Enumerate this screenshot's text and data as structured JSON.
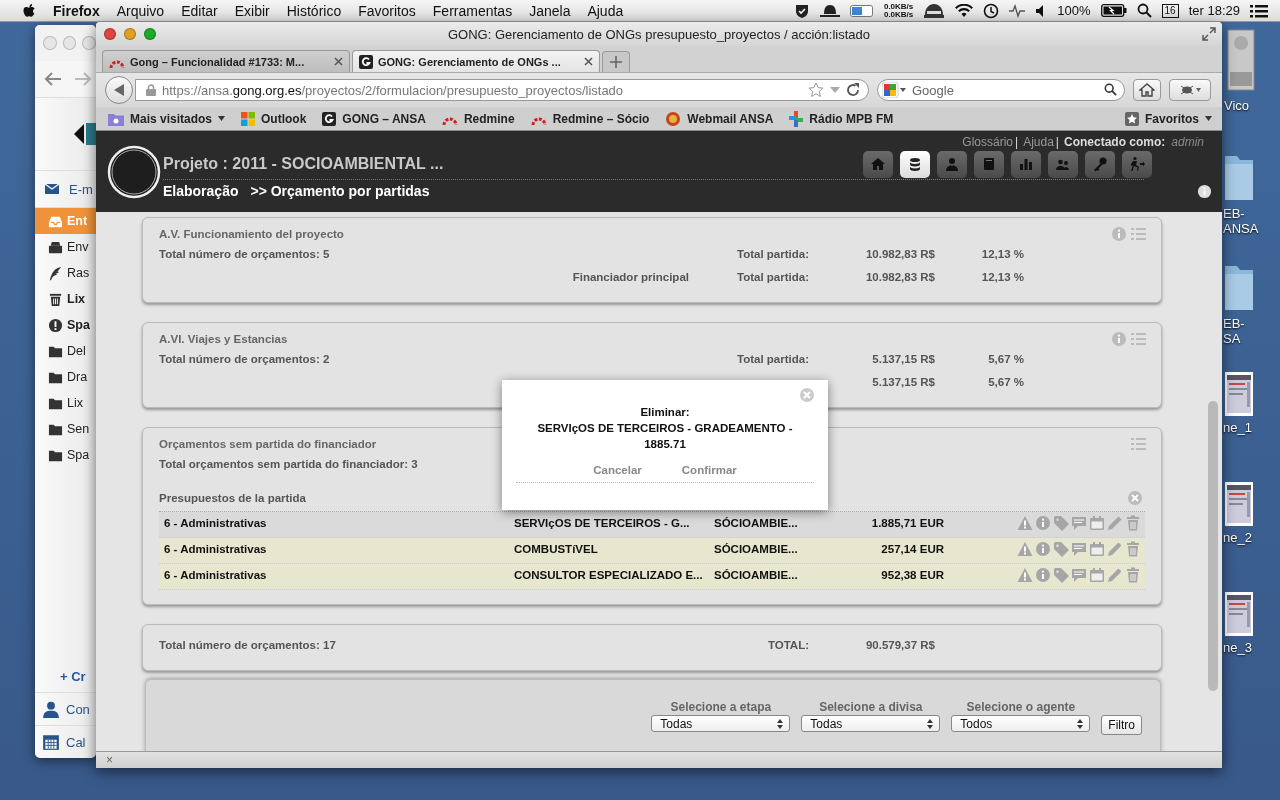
{
  "menubar": {
    "app": "Firefox",
    "menus": [
      "Arquivo",
      "Editar",
      "Exibir",
      "Histórico",
      "Favoritos",
      "Ferramentas",
      "Janela",
      "Ajuda"
    ],
    "status": {
      "net_up": "0.0KB/s",
      "net_down": "0.0KB/s",
      "battery": "100%",
      "calendar_day": "16",
      "clock": "ter 18:29"
    }
  },
  "mail_window": {
    "account": "E-m",
    "folders": [
      {
        "kind": "inbox",
        "label": "Ent",
        "selected": true,
        "bold": true
      },
      {
        "kind": "sent",
        "label": "Env",
        "selected": false,
        "bold": false
      },
      {
        "kind": "drafts",
        "label": "Ras",
        "selected": false,
        "bold": false
      },
      {
        "kind": "trash",
        "label": "Lix",
        "selected": false,
        "bold": true
      },
      {
        "kind": "spam",
        "label": "Spa",
        "selected": false,
        "bold": true
      },
      {
        "kind": "folder",
        "label": "Del",
        "selected": false,
        "bold": false
      },
      {
        "kind": "folder",
        "label": "Dra",
        "selected": false,
        "bold": false
      },
      {
        "kind": "folder",
        "label": "Lix",
        "selected": false,
        "bold": false
      },
      {
        "kind": "folder",
        "label": "Sen",
        "selected": false,
        "bold": false
      },
      {
        "kind": "folder",
        "label": "Spa",
        "selected": false,
        "bold": false
      }
    ],
    "create": "+ Cr",
    "bottom_links": [
      {
        "kind": "contacts",
        "label": "Con"
      },
      {
        "kind": "calendar",
        "label": "Cal"
      }
    ]
  },
  "desktop_icons": [
    {
      "kind": "drive",
      "lines": [
        "Vico"
      ]
    },
    {
      "kind": "folder",
      "lines": [
        "EB-",
        "ANSA"
      ]
    },
    {
      "kind": "folder",
      "lines": [
        "EB-",
        "SA"
      ]
    },
    {
      "kind": "thumbnail",
      "lines": [
        "ne_1"
      ]
    },
    {
      "kind": "thumbnail",
      "lines": [
        "ne_2"
      ]
    },
    {
      "kind": "thumbnail",
      "lines": [
        "ne_3"
      ]
    }
  ],
  "browser": {
    "title": "GONG: Gerenciamento de ONGs presupuesto_proyectos / acción:listado",
    "tabs": [
      {
        "kind": "redmine",
        "title": "Gong – Funcionalidad #1733: M...",
        "selected": false
      },
      {
        "kind": "gong",
        "title": "GONG: Gerenciamento de ONGs ...",
        "selected": true
      }
    ],
    "url": {
      "prefix": "https://ansa.",
      "domain": "gong.org.es",
      "path": "/proyectos/2/formulacion/presupuesto_proyectos/listado"
    },
    "search": {
      "placeholder": "Google"
    },
    "bookmarks": [
      {
        "kind": "folder",
        "label": "Mais visitados",
        "menu": true
      },
      {
        "kind": "windows",
        "label": "Outlook",
        "menu": false
      },
      {
        "kind": "gong",
        "label": "GONG – ANSA",
        "menu": false
      },
      {
        "kind": "redmine",
        "label": "Redmine",
        "menu": false
      },
      {
        "kind": "redmine",
        "label": "Redmine – Sócio",
        "menu": false
      },
      {
        "kind": "webmail",
        "label": "Webmail ANSA",
        "menu": false
      },
      {
        "kind": "radio",
        "label": "Rádio MPB FM",
        "menu": false
      }
    ],
    "bookmarks_menu": "Favoritos",
    "status_close": "×"
  },
  "app": {
    "top_links": [
      {
        "label": "Glossário",
        "separator": "|"
      },
      {
        "label": "Ajuda",
        "separator": "|"
      }
    ],
    "connected_label": "Conectado como:",
    "user": "admin",
    "project_title": "Projeto : 2011 - SOCIOAMBIENTAL ...",
    "section": "Elaboração",
    "page": ">> Orçamento por partidas",
    "nav": [
      {
        "kind": "home",
        "selected": false
      },
      {
        "kind": "database",
        "selected": true
      },
      {
        "kind": "person",
        "selected": false
      },
      {
        "kind": "book",
        "selected": false
      },
      {
        "kind": "chart",
        "selected": false
      },
      {
        "kind": "people",
        "selected": false
      },
      {
        "kind": "key",
        "selected": false
      },
      {
        "kind": "exit",
        "selected": false
      }
    ],
    "panels": [
      {
        "title": "A.V. Funcionamiento del proyecto",
        "info_button": true,
        "menu_button": true,
        "rows": [
          {
            "text": "Total número de orçamentos: 5",
            "label": "Total partida:",
            "amount": "10.982,83 R$",
            "percent": "12,13 %"
          },
          {
            "note": "Financiador principal",
            "label": "Total partida:",
            "amount": "10.982,83 R$",
            "percent": "12,13 %"
          }
        ]
      },
      {
        "title": "A.VI. Viajes y Estancias",
        "info_button": true,
        "menu_button": true,
        "rows": [
          {
            "text": "Total número de orçamentos: 2",
            "label": "Total partida:",
            "amount": "5.137,15 R$",
            "percent": "5,67 %"
          },
          {
            "amount": "5.137,15 R$",
            "percent": "5,67 %"
          }
        ]
      },
      {
        "title": "Orçamentos sem partida do financiador",
        "info_button": false,
        "menu_button": true,
        "rows": [
          {
            "text": "Total orçamentos sem partida do financiador: 3"
          }
        ],
        "list": {
          "heading": "Presupuestos de la partida",
          "rows": [
            {
              "category": "6 - Administrativas",
              "description": "SERVIçOS DE TERCEIROS - G...",
              "agent": "SÓCIOAMBIE...",
              "amount": "1.885,71 EUR",
              "selected": true
            },
            {
              "category": "6 - Administrativas",
              "description": "COMBUSTíVEL",
              "agent": "SÓCIOAMBIE...",
              "amount": "257,14 EUR",
              "selected": false
            },
            {
              "category": "6 - Administrativas",
              "description": "CONSULTOR ESPECIALIZADO E...",
              "agent": "SÓCIOAMBIE...",
              "amount": "952,38 EUR",
              "selected": false
            }
          ]
        }
      },
      {
        "info_button": false,
        "menu_button": false,
        "rows": [
          {
            "text": "Total número de orçamentos: 17",
            "label": "TOTAL:",
            "amount": "90.579,37 R$"
          }
        ]
      }
    ],
    "dialog": {
      "heading": "Eliminar:",
      "message": "SERVIçOS DE TERCEIROS - GRADEAMENTO - 1885.71",
      "buttons": [
        "Cancelar",
        "Confirmar"
      ]
    },
    "filters": {
      "selects": [
        {
          "label": "Selecione a etapa",
          "value": "Todas"
        },
        {
          "label": "Selecione a divisa",
          "value": "Todas"
        },
        {
          "label": "Selecione o agente",
          "value": "Todos"
        }
      ],
      "button": "Filtro"
    }
  }
}
